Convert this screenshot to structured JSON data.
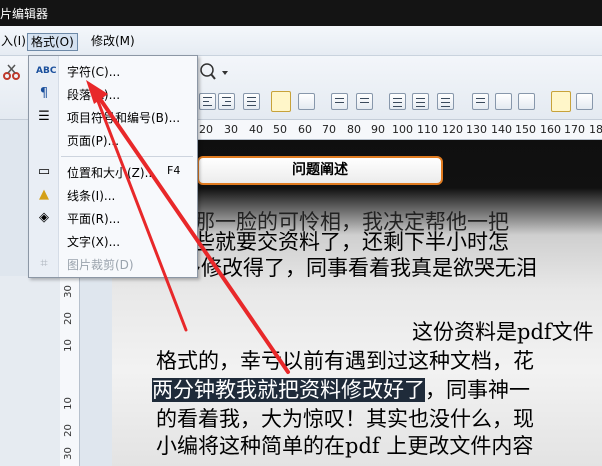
{
  "window": {
    "title": "片编辑器"
  },
  "menubar": {
    "items": [
      "入(I)",
      "格式(O)",
      "修改(M)"
    ]
  },
  "format_menu": {
    "items": [
      {
        "label": "字符(C)...",
        "icon": "abc-font-icon"
      },
      {
        "label": "段落(A)...",
        "icon": "paragraph-icon"
      },
      {
        "label": "项目符号和编号(B)...",
        "icon": "list-icon"
      },
      {
        "label": "页面(P)...",
        "icon": ""
      },
      {
        "label": "位置和大小(Z)...",
        "icon": "position-size-icon",
        "shortcut": "F4"
      },
      {
        "label": "线条(I)...",
        "icon": "line-style-icon"
      },
      {
        "label": "平面(R)...",
        "icon": "area-fill-icon"
      },
      {
        "label": "文字(X)...",
        "icon": ""
      },
      {
        "label": "图片裁剪(D)",
        "icon": "crop-icon",
        "disabled": true
      }
    ]
  },
  "ruler": {
    "h_ticks": [
      "20",
      "30",
      "40",
      "50",
      "60",
      "70",
      "80",
      "90",
      "100",
      "110",
      "120",
      "130",
      "140",
      "150",
      "160",
      "170",
      "18"
    ],
    "v_ticks": [
      "30",
      "20",
      "10",
      "10",
      "20",
      "30"
    ]
  },
  "document": {
    "banner": "问题阐述",
    "lines": [
      "看他那一脸的可怜相，我决定帮他一把",
      "我这些就要交资料了，还剩下半小时怎",
      "多修改得了，同事看着我真是欲哭无泪",
      "这份资料是pdf文件",
      "格式的，幸亏以前有遇到过这种文档，花",
      "两分钟教我就把资料修改好了",
      "，同事神一",
      "的看着我，大为惊叹！其实也没什么，现",
      "小编将这种简单的在pdf 上更改文件内容"
    ]
  },
  "colors": {
    "annotation": "#e8282a",
    "menu_border": "#8c97a5",
    "banner_border": "#e07b20"
  }
}
